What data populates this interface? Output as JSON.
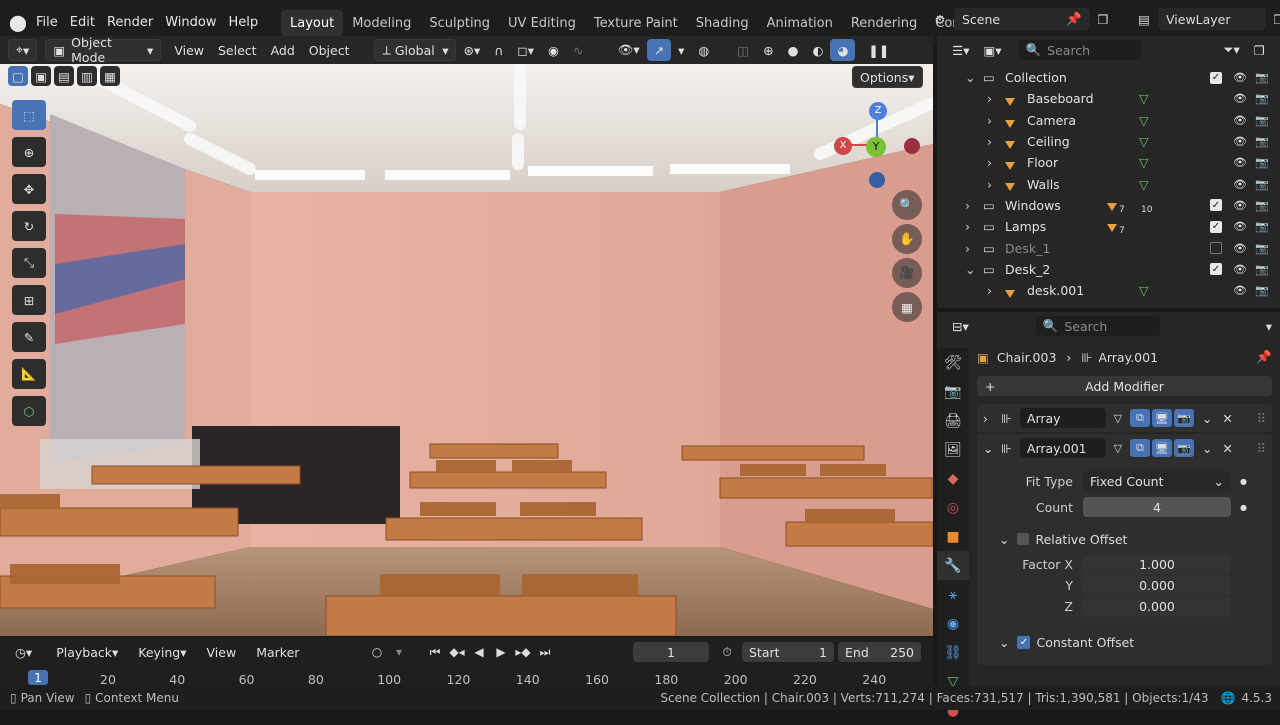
{
  "menus": [
    "File",
    "Edit",
    "Render",
    "Window",
    "Help"
  ],
  "workspaces": [
    "Layout",
    "Modeling",
    "Sculpting",
    "UV Editing",
    "Texture Paint",
    "Shading",
    "Animation",
    "Rendering",
    "Con"
  ],
  "active_workspace": "Layout",
  "scene": {
    "label": "Scene",
    "view_layer": "ViewLayer"
  },
  "viewport_header": {
    "mode": "Object Mode",
    "menus": [
      "View",
      "Select",
      "Add",
      "Object"
    ],
    "orientation": "Global",
    "options": "Options"
  },
  "gizmo": {
    "z": "Z",
    "y": "Y",
    "x": "X"
  },
  "outliner": {
    "search_placeholder": "Search",
    "items": [
      {
        "name": "Collection",
        "level": 0,
        "checked": true
      },
      {
        "name": "Baseboard",
        "level": 1
      },
      {
        "name": "Camera",
        "level": 1
      },
      {
        "name": "Ceiling",
        "level": 1
      },
      {
        "name": "Floor",
        "level": 1
      },
      {
        "name": "Walls",
        "level": 1
      },
      {
        "name": "Windows",
        "level": 0,
        "checked": true,
        "count1": "7",
        "count2": "10"
      },
      {
        "name": "Lamps",
        "level": 0,
        "checked": true,
        "count1": "7"
      },
      {
        "name": "Desk_1",
        "level": 0,
        "checked": false,
        "dim": true
      },
      {
        "name": "Desk_2",
        "level": 0,
        "checked": true
      },
      {
        "name": "desk.001",
        "level": 1
      }
    ]
  },
  "properties": {
    "search_placeholder": "Search",
    "breadcrumb_object": "Chair.003",
    "breadcrumb_modifier": "Array.001",
    "add_modifier": "Add Modifier",
    "modifiers": [
      {
        "name": "Array"
      },
      {
        "name": "Array.001"
      }
    ],
    "fit_type_label": "Fit Type",
    "fit_type_value": "Fixed Count",
    "count_label": "Count",
    "count_value": "4",
    "relative_offset": "Relative Offset",
    "factor_x_label": "Factor X",
    "factor_x": "1.000",
    "y_label": "Y",
    "factor_y": "0.000",
    "z_label": "Z",
    "factor_z": "0.000",
    "constant_offset": "Constant Offset"
  },
  "timeline": {
    "menus": [
      "Playback",
      "Keying",
      "View",
      "Marker"
    ],
    "current_frame": "1",
    "start_label": "Start",
    "start": "1",
    "end_label": "End",
    "end": "250",
    "ruler": [
      "1",
      "20",
      "40",
      "60",
      "80",
      "100",
      "120",
      "140",
      "160",
      "180",
      "200",
      "220",
      "240"
    ]
  },
  "status": {
    "pan_view": "Pan View",
    "context_menu": "Context Menu",
    "info": "Scene Collection | Chair.003 | Verts:711,274 | Faces:731,517 | Tris:1,390,581 | Objects:1/43",
    "version": "4.5.3"
  },
  "colors": {
    "accent": "#4772b3",
    "wall": "#e3b0a2",
    "desk": "#c47a45",
    "mesh_icon": "#e6a040",
    "vertex_icon": "#5fc46a"
  }
}
